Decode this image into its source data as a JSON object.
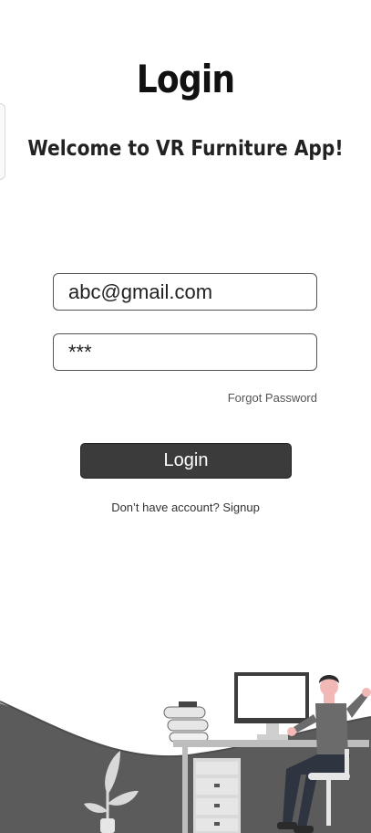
{
  "header": {
    "title": "Login",
    "subtitle": "Welcome to VR Furniture App!"
  },
  "form": {
    "email_value": "abc@gmail.com",
    "password_value": "***",
    "forgot_password": "Forgot Password",
    "login_button": "Login",
    "signup_prompt": "Don’t have account? Signup"
  },
  "colors": {
    "button_bg": "#3b3b3b",
    "illustration_gray": "#595959"
  },
  "illustration": {
    "icon": "person-at-desk-illustration"
  }
}
